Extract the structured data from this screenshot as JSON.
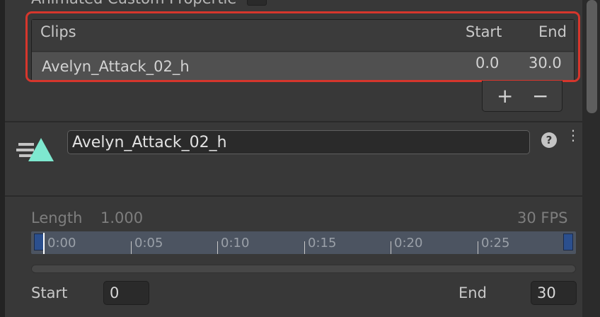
{
  "top": {
    "property_label": "Animated Custom Propertie"
  },
  "clips": {
    "headers": {
      "clips": "Clips",
      "start": "Start",
      "end": "End"
    },
    "rows": [
      {
        "name": "Avelyn_Attack_02_h",
        "start": "0.0",
        "end": "30.0"
      }
    ],
    "add_label": "+",
    "remove_label": "−"
  },
  "clip_editor": {
    "name_value": "Avelyn_Attack_02_h",
    "help_label": "?",
    "menu_label": "⋮",
    "icon": "animation-clip-icon",
    "length_label": "Length",
    "length_value": "1.000",
    "fps": "30 FPS",
    "ticks": [
      "0:00",
      "0:05",
      "0:10",
      "0:15",
      "0:20",
      "0:25"
    ],
    "start_label": "Start",
    "start_value": "0",
    "end_label": "End",
    "end_value": "30"
  },
  "colors": {
    "highlight": "#d6362c",
    "icon": "#7ee8cf",
    "timeline": "#4c5461"
  }
}
